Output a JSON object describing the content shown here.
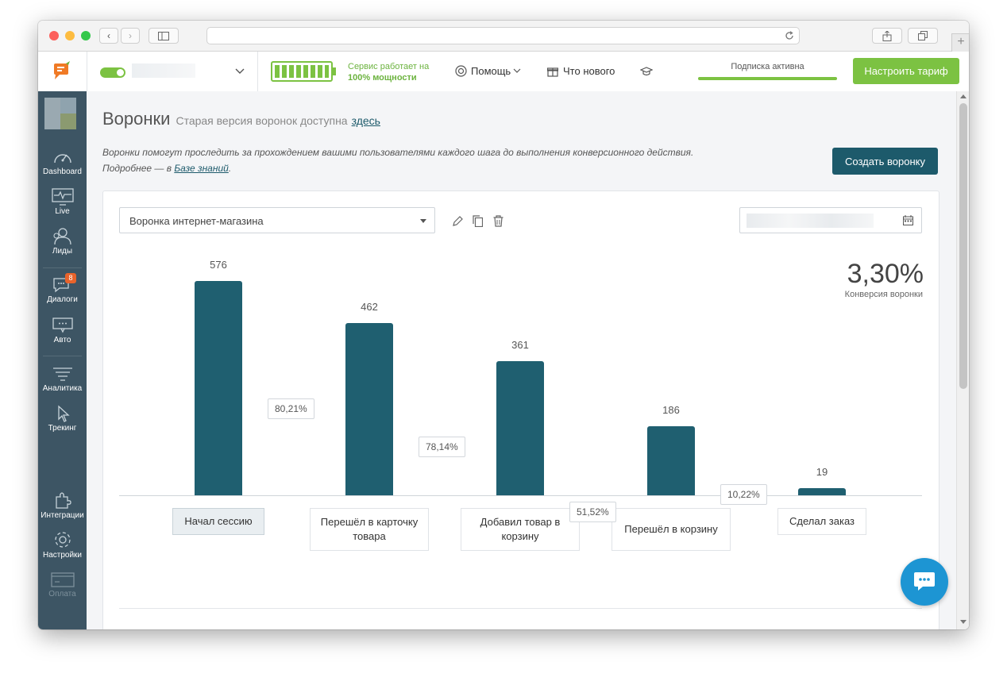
{
  "topbar": {
    "service_text_1": "Сервис работает на",
    "service_text_2": "100% мощности",
    "help": "Помощь",
    "whats_new": "Что нового",
    "subscription": "Подписка активна",
    "tariff_button": "Настроить тариф"
  },
  "sidebar": {
    "items": [
      {
        "label": "Dashboard",
        "icon": "speedometer-icon"
      },
      {
        "label": "Live",
        "icon": "monitor-pulse-icon"
      },
      {
        "label": "Лиды",
        "icon": "users-icon"
      },
      {
        "label": "Диалоги",
        "icon": "chat-bubbles-icon",
        "badge": "8"
      },
      {
        "label": "Авто",
        "icon": "auto-message-icon"
      },
      {
        "label": "Аналитика",
        "icon": "funnel-lines-icon"
      },
      {
        "label": "Трекинг",
        "icon": "cursor-click-icon"
      },
      {
        "label": "Интеграции",
        "icon": "puzzle-icon"
      },
      {
        "label": "Настройки",
        "icon": "gear-icon"
      },
      {
        "label": "Оплата",
        "icon": "card-icon"
      }
    ]
  },
  "page": {
    "title": "Воронки",
    "old_version_text": "Старая версия воронок доступна",
    "old_version_link": "здесь",
    "description_1": "Воронки помогут проследить за прохождением вашими пользователями каждого шага до выполнения конверсионного действия.",
    "description_2_prefix": "Подробнее — в",
    "description_2_link": "Базе знаний",
    "description_2_suffix": ".",
    "create_button": "Создать воронку"
  },
  "funnel": {
    "selected": "Воронка интернет-магазина",
    "conversion_value": "3,30%",
    "conversion_label": "Конверсия воронки"
  },
  "chart_data": {
    "type": "bar",
    "categories": [
      "Начал сессию",
      "Перешёл в карточку товара",
      "Добавил товар в корзину",
      "Перешёл в корзину",
      "Сделал заказ"
    ],
    "values": [
      576,
      462,
      361,
      186,
      19
    ],
    "step_conversions": [
      "80,21%",
      "78,14%",
      "51,52%",
      "10,22%"
    ],
    "ylim": [
      0,
      576
    ],
    "grid": false
  },
  "colors": {
    "bar": "#1f5f70",
    "sidebar": "#3d5564",
    "accent_green": "#7cc242",
    "dark_button": "#1d5a6b"
  }
}
